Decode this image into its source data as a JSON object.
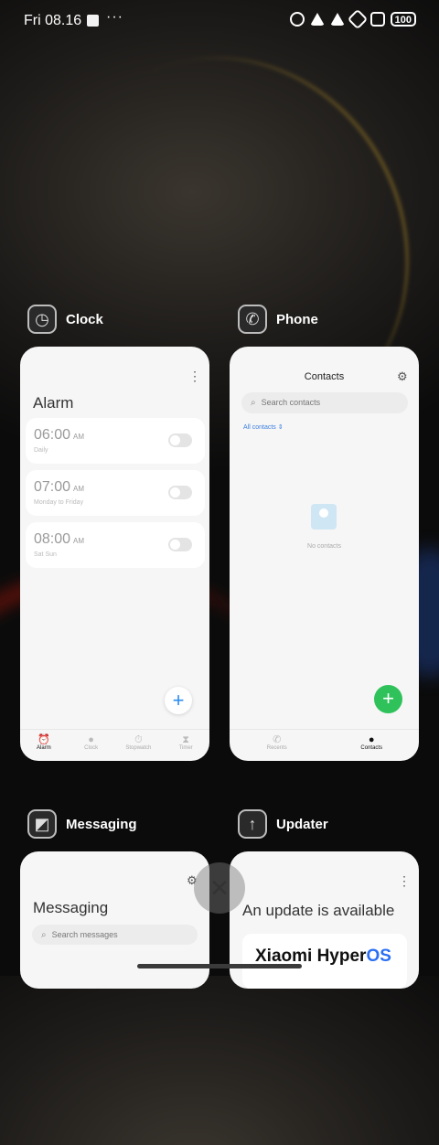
{
  "status_bar": {
    "time": "Fri 08.16",
    "dots": "···",
    "battery": "100"
  },
  "apps": {
    "clock": {
      "name": "Clock",
      "icon": "clock-icon",
      "title": "Alarm",
      "alarms": [
        {
          "time": "06:00",
          "ampm": "AM",
          "repeat": "Daily"
        },
        {
          "time": "07:00",
          "ampm": "AM",
          "repeat": "Monday to Friday"
        },
        {
          "time": "08:00",
          "ampm": "AM",
          "repeat": "Sat Sun"
        }
      ],
      "add_label": "+",
      "nav": [
        "Alarm",
        "Clock",
        "Stopwatch",
        "Timer"
      ]
    },
    "phone": {
      "name": "Phone",
      "icon": "phone-icon",
      "title": "Contacts",
      "search_placeholder": "Search contacts",
      "filter": "All contacts ⇕",
      "empty": "No contacts",
      "add_label": "+",
      "nav": [
        "Recents",
        "Contacts"
      ]
    },
    "messaging": {
      "name": "Messaging",
      "icon": "messaging-icon",
      "title": "Messaging",
      "search_placeholder": "Search messages"
    },
    "updater": {
      "name": "Updater",
      "icon": "updater-icon",
      "title": "An update is available",
      "brand_a": "Xiaomi Hyper",
      "brand_b": "OS"
    }
  },
  "close_label": "✕"
}
